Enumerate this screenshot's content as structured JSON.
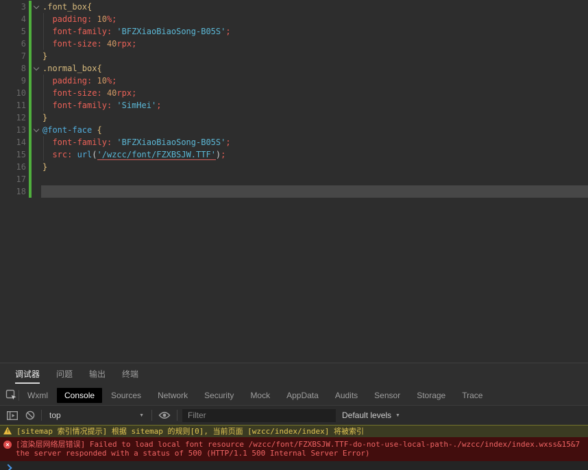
{
  "colors": {
    "editor_bg": "#2d2d2d",
    "current_line": "#474747",
    "gutter_green": "#4fae3d",
    "line_number": "#6a6a6a",
    "selector": "#d7ba7d",
    "brace": "#e5c07b",
    "property": "#ed6258",
    "number": "#d19a66",
    "string": "#5cb8d6",
    "keyword": "#53aedd",
    "paren": "#cfcfcf",
    "link_underline": "#d4615c",
    "panel_bg": "#2f2f2f",
    "toolbar_bg": "#2b2b2b",
    "console_bg": "#242424",
    "tab_active_bg": "#000000",
    "warning_bg": "#3b3b22",
    "warning_text": "#e2c553",
    "warning_border": "#72722b",
    "error_bg": "#420d0d",
    "error_text": "#f16464",
    "error_icon": "#df4b4b",
    "prompt_blue": "#4a96e8"
  },
  "glyphs": {
    "caret_down": "▼",
    "exclaim": "!",
    "multiply": "×"
  },
  "editor": {
    "language": "wxss",
    "lines": [
      {
        "num": "3",
        "fold": true,
        "tokens": [
          [
            "selector",
            ".font_box"
          ],
          [
            "brace",
            "{"
          ]
        ]
      },
      {
        "num": "4",
        "guide": true,
        "tokens": [
          [
            "ws",
            "  "
          ],
          [
            "prop",
            "padding"
          ],
          [
            "punct",
            ":"
          ],
          [
            "ws",
            " "
          ],
          [
            "num",
            "10"
          ],
          [
            "punct",
            "%;"
          ]
        ]
      },
      {
        "num": "5",
        "guide": true,
        "tokens": [
          [
            "ws",
            "  "
          ],
          [
            "prop",
            "font-family"
          ],
          [
            "punct",
            ":"
          ],
          [
            "ws",
            " "
          ],
          [
            "str",
            "'BFZXiaoBiaoSong-B05S'"
          ],
          [
            "punct",
            ";"
          ]
        ]
      },
      {
        "num": "6",
        "guide": true,
        "tokens": [
          [
            "ws",
            "  "
          ],
          [
            "prop",
            "font-size"
          ],
          [
            "punct",
            ":"
          ],
          [
            "ws",
            " "
          ],
          [
            "num",
            "40"
          ],
          [
            "punct",
            "rpx;"
          ]
        ]
      },
      {
        "num": "7",
        "tokens": [
          [
            "brace",
            "}"
          ]
        ]
      },
      {
        "num": "8",
        "fold": true,
        "tokens": [
          [
            "selector",
            ".normal_box"
          ],
          [
            "brace",
            "{"
          ]
        ]
      },
      {
        "num": "9",
        "guide": true,
        "tokens": [
          [
            "ws",
            "  "
          ],
          [
            "prop",
            "padding"
          ],
          [
            "punct",
            ":"
          ],
          [
            "ws",
            " "
          ],
          [
            "num",
            "10"
          ],
          [
            "punct",
            "%;"
          ]
        ]
      },
      {
        "num": "10",
        "guide": true,
        "tokens": [
          [
            "ws",
            "  "
          ],
          [
            "prop",
            "font-size"
          ],
          [
            "punct",
            ":"
          ],
          [
            "ws",
            " "
          ],
          [
            "num",
            "40"
          ],
          [
            "punct",
            "rpx;"
          ]
        ]
      },
      {
        "num": "11",
        "guide": true,
        "tokens": [
          [
            "ws",
            "  "
          ],
          [
            "prop",
            "font-family"
          ],
          [
            "punct",
            ":"
          ],
          [
            "ws",
            " "
          ],
          [
            "str",
            "'SimHei'"
          ],
          [
            "punct",
            ";"
          ]
        ]
      },
      {
        "num": "12",
        "tokens": [
          [
            "brace",
            "}"
          ]
        ]
      },
      {
        "num": "13",
        "fold": true,
        "tokens": [
          [
            "kw",
            "@font-face"
          ],
          [
            "ws",
            " "
          ],
          [
            "brace",
            "{"
          ]
        ]
      },
      {
        "num": "14",
        "guide": true,
        "tokens": [
          [
            "ws",
            "  "
          ],
          [
            "prop",
            "font-family"
          ],
          [
            "punct",
            ":"
          ],
          [
            "ws",
            " "
          ],
          [
            "str",
            "'BFZXiaoBiaoSong-B05S'"
          ],
          [
            "punct",
            ";"
          ]
        ]
      },
      {
        "num": "15",
        "guide": true,
        "tokens": [
          [
            "ws",
            "  "
          ],
          [
            "prop",
            "src"
          ],
          [
            "punct",
            ":"
          ],
          [
            "ws",
            " "
          ],
          [
            "kw",
            "url"
          ],
          [
            "paren",
            "("
          ],
          [
            "strlink",
            "'/wzcc/font/FZXBSJW.TTF'"
          ],
          [
            "paren",
            ")"
          ],
          [
            "punct",
            ";"
          ]
        ]
      },
      {
        "num": "16",
        "tokens": [
          [
            "brace",
            "}"
          ]
        ]
      },
      {
        "num": "17",
        "tokens": []
      },
      {
        "num": "18",
        "current": true,
        "tokens": []
      }
    ]
  },
  "panel": {
    "primary_tabs": [
      {
        "label": "调试器",
        "name": "debugger",
        "active": true
      },
      {
        "label": "问题",
        "name": "problems"
      },
      {
        "label": "输出",
        "name": "output"
      },
      {
        "label": "终端",
        "name": "terminal"
      }
    ],
    "devtools_tabs": [
      {
        "label": "Wxml",
        "name": "wxml"
      },
      {
        "label": "Console",
        "name": "console",
        "active": true
      },
      {
        "label": "Sources",
        "name": "sources"
      },
      {
        "label": "Network",
        "name": "network"
      },
      {
        "label": "Security",
        "name": "security"
      },
      {
        "label": "Mock",
        "name": "mock"
      },
      {
        "label": "AppData",
        "name": "appdata"
      },
      {
        "label": "Audits",
        "name": "audits"
      },
      {
        "label": "Sensor",
        "name": "sensor"
      },
      {
        "label": "Storage",
        "name": "storage"
      },
      {
        "label": "Trace",
        "name": "trace"
      }
    ],
    "toolbar": {
      "context_selector": "top",
      "filter_placeholder": "Filter",
      "levels_label": "Default levels"
    },
    "console": {
      "warning": "[sitemap 索引情况提示] 根据 sitemap 的规则[0], 当前页面 [wzcc/index/index] 将被索引",
      "error_line1": "[渲染层网络层错误] Failed to load local font resource /wzcc/font/FZXBSJW.TTF-do-not-use-local-path-./wzcc/index/index.wxss&15&7",
      "error_line2": "the server responded with a status of 500 (HTTP/1.1 500 Internal Server Error)"
    }
  }
}
